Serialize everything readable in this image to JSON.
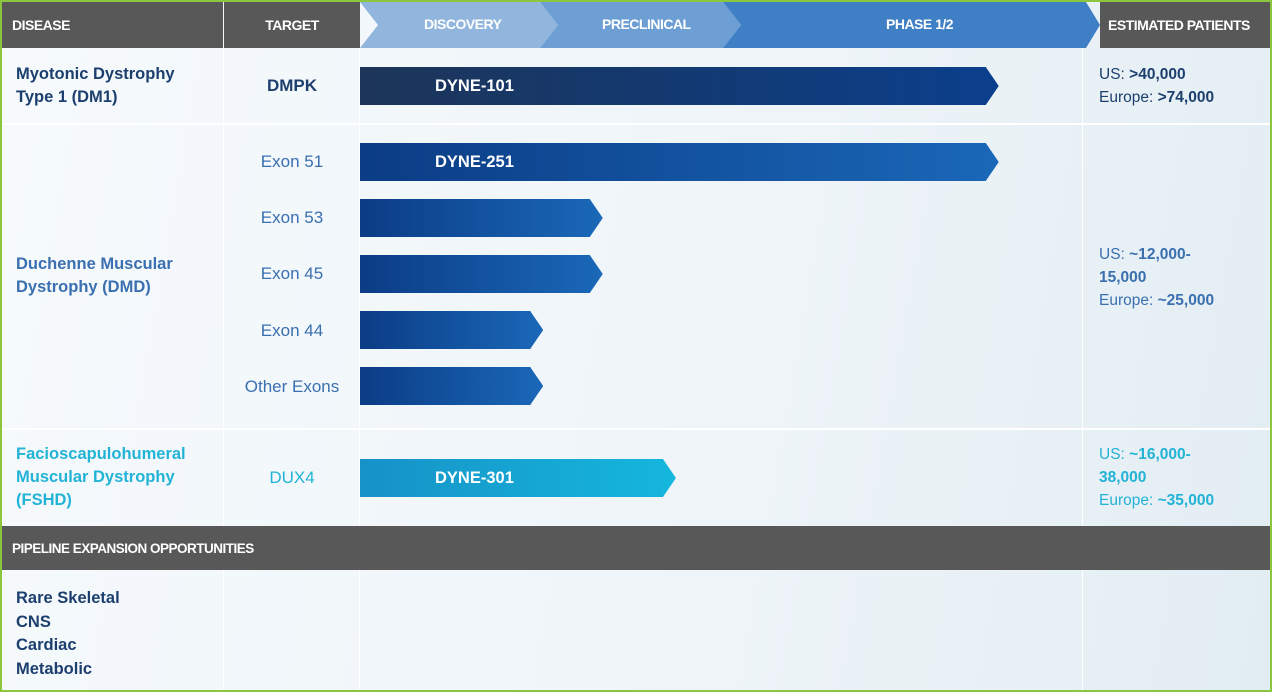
{
  "header": {
    "disease": "DISEASE",
    "target": "TARGET",
    "discovery": "DISCOVERY",
    "preclinical": "PRECLINICAL",
    "phase": "PHASE 1/2",
    "estimated": "ESTIMATED PATIENTS"
  },
  "rows": {
    "dm1": {
      "disease": [
        "Myotonic Dystrophy",
        "Type 1 (DM1)"
      ],
      "target": "DMPK",
      "est_us_label": "US: ",
      "est_us_value": ">40,000",
      "est_eu_label": "Europe: ",
      "est_eu_value": ">74,000"
    },
    "dmd": {
      "disease": [
        "Duchenne Muscular",
        "Dystrophy (DMD)"
      ],
      "targets": [
        "Exon 51",
        "Exon 53",
        "Exon 45",
        "Exon 44",
        "Other Exons"
      ],
      "est_us_label": "US: ",
      "est_us_value_1": "~12,000-",
      "est_us_value_2": "15,000",
      "est_eu_label": "Europe: ",
      "est_eu_value": "~25,000"
    },
    "fshd": {
      "disease": [
        "Facioscapulohumeral",
        "Muscular Dystrophy",
        "(FSHD)"
      ],
      "target": "DUX4",
      "est_us_label": "US: ",
      "est_us_value_1": "~16,000-",
      "est_us_value_2": "38,000",
      "est_eu_label": "Europe: ",
      "est_eu_value": "~35,000"
    }
  },
  "expansion": {
    "header": "PIPELINE EXPANSION OPPORTUNITIES",
    "items": [
      "Rare Skeletal",
      "CNS",
      "Cardiac",
      "Metabolic"
    ]
  },
  "colors": {
    "frame_border": "#8cc63f",
    "header_dark": "#585858",
    "stage_discovery": "#91b5dd",
    "stage_preclinical": "#6d9fd4",
    "stage_phase": "#3f7fc5",
    "dm1_bar_start": "#1c3558",
    "dm1_bar_end": "#0b3f8c",
    "dmd_bar_start": "#0b3c85",
    "dmd_bar_end": "#1a68b8",
    "fshd_bar_start": "#1692c8",
    "fshd_bar_end": "#15b7dc"
  },
  "chart_data": {
    "type": "bar",
    "stages": [
      "DISCOVERY",
      "PRECLINICAL",
      "PHASE 1/2"
    ],
    "note_units": "progress in stage units: 0 = start of discovery, 1 = end of discovery, 2 = end of preclinical, 3 = end of phase 1/2 column",
    "series": [
      {
        "program": "DMPK",
        "label": "DYNE-101",
        "progress": 2.75
      },
      {
        "program": "Exon 51",
        "label": "DYNE-251",
        "progress": 2.75
      },
      {
        "program": "Exon 53",
        "label": "",
        "progress": 1.25
      },
      {
        "program": "Exon 45",
        "label": "",
        "progress": 1.25
      },
      {
        "program": "Exon 44",
        "label": "",
        "progress": 0.93
      },
      {
        "program": "Other Exons",
        "label": "",
        "progress": 0.93
      },
      {
        "program": "DUX4",
        "label": "DYNE-301",
        "progress": 1.65
      }
    ]
  }
}
